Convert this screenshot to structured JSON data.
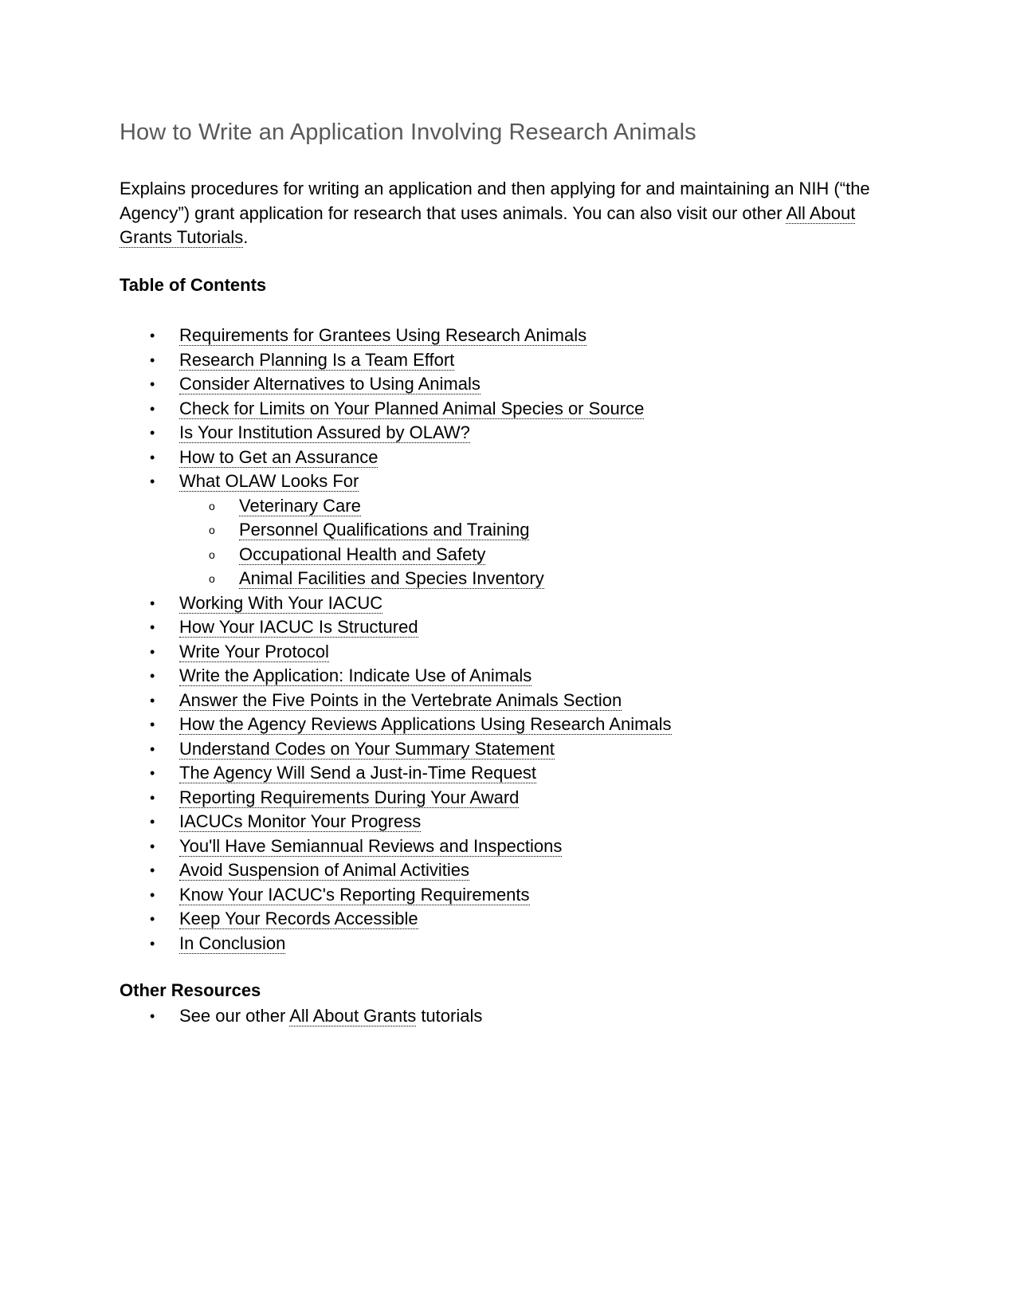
{
  "document": {
    "title": "How to Write an Application Involving Research Animals",
    "intro": {
      "text_before_link": "Explains procedures for writing an application and then applying for and maintaining an NIH (“the Agency”) grant application for research that uses animals. You can also visit our other ",
      "link_text": "All About Grants Tutorials",
      "text_after_link": "."
    },
    "toc": {
      "heading": "Table of Contents",
      "bullet_glyph": "•",
      "sub_bullet_glyph": "o",
      "items": [
        {
          "label": "Requirements for Grantees Using Research Animals",
          "level": 1
        },
        {
          "label": "Research Planning Is a Team Effort",
          "level": 1
        },
        {
          "label": "Consider Alternatives to Using Animals",
          "level": 1
        },
        {
          "label": "Check for Limits on Your Planned Animal Species or Source",
          "level": 1
        },
        {
          "label": "Is Your Institution Assured by OLAW?",
          "level": 1
        },
        {
          "label": "How to Get an Assurance",
          "level": 1
        },
        {
          "label": "What OLAW Looks For",
          "level": 1
        },
        {
          "label": "Veterinary Care",
          "level": 2
        },
        {
          "label": "Personnel Qualifications and Training",
          "level": 2
        },
        {
          "label": "Occupational Health and Safety",
          "level": 2
        },
        {
          "label": "Animal Facilities and Species Inventory",
          "level": 2
        },
        {
          "label": "Working With Your IACUC",
          "level": 1
        },
        {
          "label": "How Your IACUC Is Structured",
          "level": 1
        },
        {
          "label": "Write Your Protocol",
          "level": 1
        },
        {
          "label": "Write the Application: Indicate Use of Animals",
          "level": 1
        },
        {
          "label": "Answer the Five Points in the Vertebrate Animals Section",
          "level": 1
        },
        {
          "label": "How the Agency Reviews Applications Using Research Animals",
          "level": 1
        },
        {
          "label": "Understand Codes on Your Summary Statement",
          "level": 1
        },
        {
          "label": "The Agency Will Send a Just-in-Time Request",
          "level": 1
        },
        {
          "label": "Reporting Requirements During Your Award",
          "level": 1
        },
        {
          "label": "IACUCs Monitor Your Progress",
          "level": 1
        },
        {
          "label": "You'll Have Semiannual Reviews and Inspections",
          "level": 1
        },
        {
          "label": "Avoid Suspension of Animal Activities",
          "level": 1
        },
        {
          "label": "Know Your IACUC's Reporting Requirements",
          "level": 1
        },
        {
          "label": "Keep Your Records Accessible",
          "level": 1
        },
        {
          "label": "In Conclusion",
          "level": 1
        }
      ]
    },
    "other_resources": {
      "heading": "Other Resources",
      "items": [
        {
          "text_before_link": "See our other ",
          "link_text": "All About Grants",
          "text_after_link": " tutorials"
        }
      ]
    }
  }
}
